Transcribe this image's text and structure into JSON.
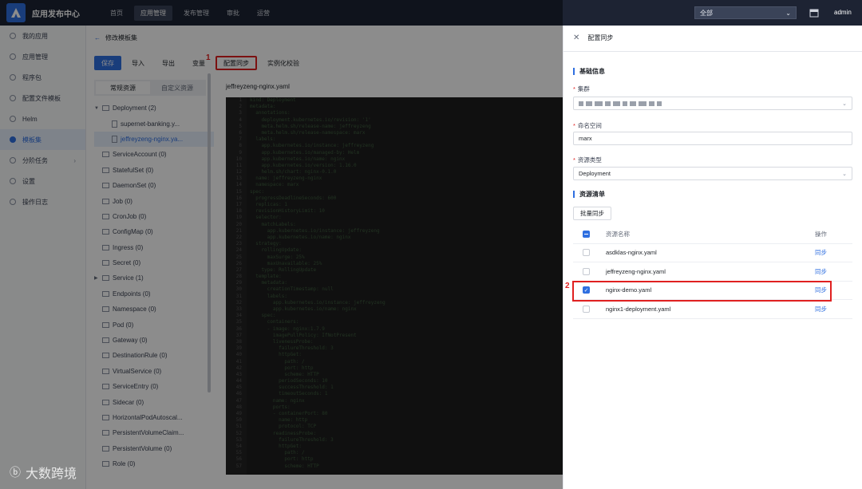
{
  "topbar": {
    "app_title": "应用发布中心",
    "nav": [
      "首页",
      "应用管理",
      "发布管理",
      "审批",
      "运营"
    ],
    "active_nav": 1,
    "env_select": "全部",
    "user": "admin"
  },
  "sidebar": {
    "items": [
      {
        "label": "我的应用"
      },
      {
        "label": "应用管理"
      },
      {
        "label": "程序包"
      },
      {
        "label": "配置文件模板"
      },
      {
        "label": "Helm"
      },
      {
        "label": "模板集"
      },
      {
        "label": "分阶任务"
      },
      {
        "label": "设置"
      },
      {
        "label": "操作日志"
      }
    ],
    "active_index": 5
  },
  "main": {
    "back_label": "修改模板集",
    "toolbar": [
      "保存",
      "导入",
      "导出",
      "变量",
      "配置同步",
      "实例化校验"
    ],
    "tree_tabs": [
      "常规资源",
      "自定义资源"
    ],
    "tree": [
      {
        "label": "Deployment (2)",
        "level": 0,
        "type": "folder",
        "expanded": true
      },
      {
        "label": "supernet-banking.y...",
        "level": 1,
        "type": "file"
      },
      {
        "label": "jeffreyzeng-nginx.ya...",
        "level": 1,
        "type": "file",
        "selected": true
      },
      {
        "label": "ServiceAccount (0)",
        "level": 0,
        "type": "folder"
      },
      {
        "label": "StatefulSet (0)",
        "level": 0,
        "type": "folder"
      },
      {
        "label": "DaemonSet (0)",
        "level": 0,
        "type": "folder"
      },
      {
        "label": "Job (0)",
        "level": 0,
        "type": "folder"
      },
      {
        "label": "CronJob (0)",
        "level": 0,
        "type": "folder"
      },
      {
        "label": "ConfigMap (0)",
        "level": 0,
        "type": "folder"
      },
      {
        "label": "Ingress (0)",
        "level": 0,
        "type": "folder"
      },
      {
        "label": "Secret (0)",
        "level": 0,
        "type": "folder"
      },
      {
        "label": "Service (1)",
        "level": 0,
        "type": "folder",
        "collapsed": true
      },
      {
        "label": "Endpoints (0)",
        "level": 0,
        "type": "folder"
      },
      {
        "label": "Namespace (0)",
        "level": 0,
        "type": "folder"
      },
      {
        "label": "Pod (0)",
        "level": 0,
        "type": "folder"
      },
      {
        "label": "Gateway (0)",
        "level": 0,
        "type": "folder"
      },
      {
        "label": "DestinationRule (0)",
        "level": 0,
        "type": "folder"
      },
      {
        "label": "VirtualService (0)",
        "level": 0,
        "type": "folder"
      },
      {
        "label": "ServiceEntry (0)",
        "level": 0,
        "type": "folder"
      },
      {
        "label": "Sidecar (0)",
        "level": 0,
        "type": "folder"
      },
      {
        "label": "HorizontalPodAutoscal...",
        "level": 0,
        "type": "folder"
      },
      {
        "label": "PersistentVolumeClaim...",
        "level": 0,
        "type": "folder"
      },
      {
        "label": "PersistentVolume (0)",
        "level": 0,
        "type": "folder"
      },
      {
        "label": "Role (0)",
        "level": 0,
        "type": "folder"
      }
    ],
    "file_title": "jeffreyzeng-nginx.yaml",
    "code_lines": [
      "kind: Deployment",
      "metadata:",
      "  annotations:",
      "    deployment.kubernetes.io/revision: '1'",
      "    meta.helm.sh/release-name: jeffreyzeng",
      "    meta.helm.sh/release-namespace: marx",
      "  labels:",
      "    app.kubernetes.io/instance: jeffreyzeng",
      "    app.kubernetes.io/managed-by: Helm",
      "    app.kubernetes.io/name: nginx",
      "    app.kubernetes.io/version: 1.16.0",
      "    helm.sh/chart: nginx-0.1.0",
      "  name: jeffreyzeng-nginx",
      "  namespace: marx",
      "spec:",
      "  progressDeadlineSeconds: 600",
      "  replicas: 1",
      "  revisionHistoryLimit: 10",
      "  selector:",
      "    matchLabels:",
      "      app.kubernetes.io/instance: jeffreyzeng",
      "      app.kubernetes.io/name: nginx",
      "  strategy:",
      "    rollingUpdate:",
      "      maxSurge: 25%",
      "      maxUnavailable: 25%",
      "    type: RollingUpdate",
      "  template:",
      "    metadata:",
      "      creationTimestamp: null",
      "      labels:",
      "        app.kubernetes.io/instance: jeffreyzeng",
      "        app.kubernetes.io/name: nginx",
      "    spec:",
      "      containers:",
      "      - image: nginx:1.7.9",
      "        imagePullPolicy: IfNotPresent",
      "        livenessProbe:",
      "          failureThreshold: 3",
      "          httpGet:",
      "            path: /",
      "            port: http",
      "            scheme: HTTP",
      "          periodSeconds: 10",
      "          successThreshold: 1",
      "          timeoutSeconds: 1",
      "        name: nginx",
      "        ports:",
      "        - containerPort: 80",
      "          name: http",
      "          protocol: TCP",
      "        readinessProbe:",
      "          failureThreshold: 3",
      "          httpGet:",
      "            path: /",
      "            port: http",
      "            scheme: HTTP"
    ]
  },
  "annotations": {
    "mark1": "1",
    "mark2": "2"
  },
  "watermark": "大数跨境",
  "drawer": {
    "title": "配置同步",
    "basic_info": "基础信息",
    "cluster_label": "集群",
    "namespace_label": "命名空间",
    "namespace_value": "marx",
    "resource_type_label": "资源类型",
    "resource_type_value": "Deployment",
    "resource_list": "资源清单",
    "batch_sync": "批量同步",
    "table_headers": {
      "name": "资源名称",
      "op": "操作"
    },
    "rows": [
      {
        "name": "asdklas-nginx.yaml",
        "op": "同步",
        "checked": false
      },
      {
        "name": "jeffreyzeng-nginx.yaml",
        "op": "同步",
        "checked": false
      },
      {
        "name": "nginx-demo.yaml",
        "op": "同步",
        "checked": true
      },
      {
        "name": "nginx1-deployment.yaml",
        "op": "同步",
        "checked": false
      }
    ]
  },
  "colors": {
    "primary": "#2f6fe0",
    "topbar": "#1d2333",
    "highlight": "#e02020"
  }
}
